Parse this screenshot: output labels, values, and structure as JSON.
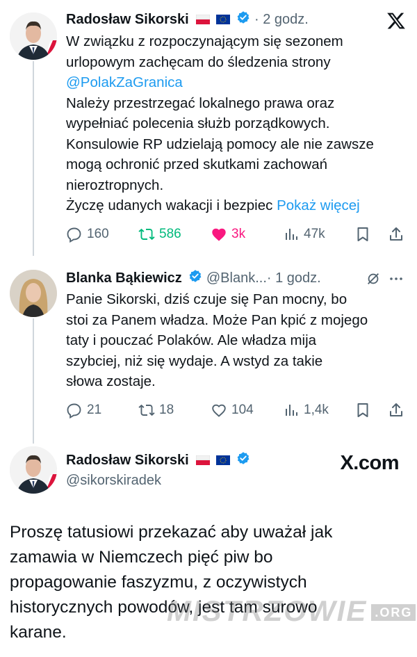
{
  "tweet1": {
    "author": "Radosław Sikorski",
    "time": "· 2 godz.",
    "lines": [
      "W związku z rozpoczynającym się sezonem",
      "urlopowym zachęcam do śledzenia strony"
    ],
    "mention": "@PolakZaGranica",
    "lines2": [
      "Należy przestrzegać lokalnego prawa oraz",
      "wypełniać polecenia służb porządkowych.",
      "Konsulowie RP udzielają pomocy ale nie zawsze",
      "mogą ochronić przed skutkami zachowań",
      "nieroztropnych."
    ],
    "last_line": "Życzę udanych wakacji i bezpiec",
    "show_more": "Pokaż więcej",
    "replies": "160",
    "reposts": "586",
    "likes": "3k",
    "views": "47k"
  },
  "tweet2": {
    "author": "Blanka Bąkiewicz",
    "handle": "@Blank...",
    "time": "· 1 godz.",
    "lines": [
      "Panie Sikorski, dziś czuje się Pan mocny, bo",
      "stoi za Panem władza. Może Pan kpić z mojego",
      "taty i pouczać Polaków. Ale władza mija",
      "szybciej, niż się wydaje. A wstyd za takie",
      "słowa zostaje."
    ],
    "replies": "21",
    "reposts": "18",
    "likes": "104",
    "views": "1,4k"
  },
  "tweet3": {
    "author": "Radosław Sikorski",
    "handle": "@sikorskiradek",
    "site": "X.com",
    "lines": [
      "Proszę tatusiowi przekazać aby uważał jak",
      "zamawia w Niemczech pięć piw bo",
      "propagowanie faszyzmu, z oczywistych",
      "historycznych powodów, jest tam surowo",
      "karane."
    ]
  },
  "watermark": {
    "text": "MISTRZOWIE",
    "suffix": ".ORG"
  },
  "colors": {
    "link": "#1d9bf0",
    "repost": "#00ba7c",
    "like": "#f91880",
    "muted": "#536471"
  },
  "icons": [
    "x-logo-icon",
    "verified-icon",
    "poland-flag-icon",
    "eu-flag-icon",
    "reply-icon",
    "repost-icon",
    "like-icon",
    "views-icon",
    "bookmark-icon",
    "share-icon",
    "grok-icon",
    "more-icon"
  ]
}
